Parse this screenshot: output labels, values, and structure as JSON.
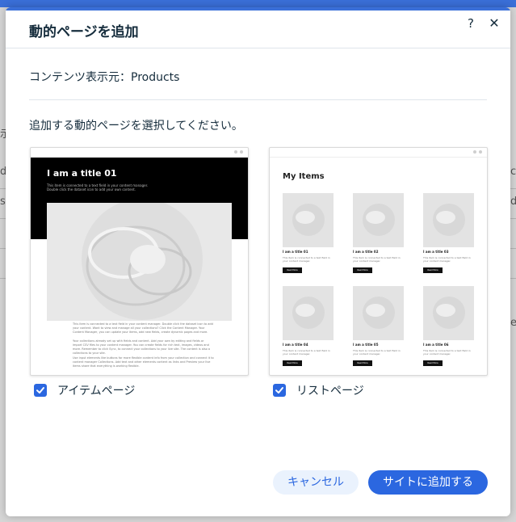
{
  "background": {
    "fragments": [
      "示",
      "d",
      "s",
      "c",
      "d",
      "e"
    ]
  },
  "dialog": {
    "title": "動的ページを追加",
    "help_label": "?",
    "close_label": "✕",
    "source_text": "コンテンツ表示元：Products",
    "instruction": "追加する動的ページを選択してください。",
    "options": [
      {
        "label": "アイテムページ",
        "checked": true,
        "preview": {
          "title": "I am a title 01",
          "subtitle": "This item is connected to a text field in your content manager. Double click the dataset icon to add your own content.",
          "paragraphs": [
            "This item is connected to a text field in your content manager. Double click the dataset icon to add your content. Want to view and manage all your collections? Click the Content Manager. Your Content Manager, you can update your items, add new fields, create dynamic pages and more.",
            "Your collections already set up with fields and content. Add your own by editing and fields or import CSV files to your content manager. You can create fields for rich text, images, videos and more. Remember to click Sync, to connect your collections to your live site. The content is also a collections to your site.",
            "Use input elements like buttons for more flexible content info from your collection and connect it to content manager Collections. Add text and other elements content as links and Preview your live items share that everything is working flexible."
          ]
        }
      },
      {
        "label": "リストページ",
        "checked": true,
        "preview": {
          "heading": "My Items",
          "items": [
            {
              "title": "I am a title 01",
              "desc": "This item is connected to a text field in your content manager.",
              "button": "Read More"
            },
            {
              "title": "I am a title 02",
              "desc": "This item is connected to a text field in your content manager.",
              "button": "Read More"
            },
            {
              "title": "I am a title 03",
              "desc": "This item is connected to a text field in your content manager.",
              "button": "Read More"
            },
            {
              "title": "I am a title 04",
              "desc": "This item is connected to a text field in your content manager.",
              "button": "Read More"
            },
            {
              "title": "I am a title 05",
              "desc": "This item is connected to a text field in your content manager.",
              "button": "Read More"
            },
            {
              "title": "I am a title 06",
              "desc": "This item is connected to a text field in your content manager.",
              "button": "Read More"
            }
          ]
        }
      }
    ],
    "cancel_label": "キャンセル",
    "confirm_label": "サイトに追加する"
  },
  "colors": {
    "accent": "#2b67e0",
    "top_bar": "#3a6fd8",
    "text": "#162d3d",
    "secondary_button_bg": "#eaf2fd"
  }
}
